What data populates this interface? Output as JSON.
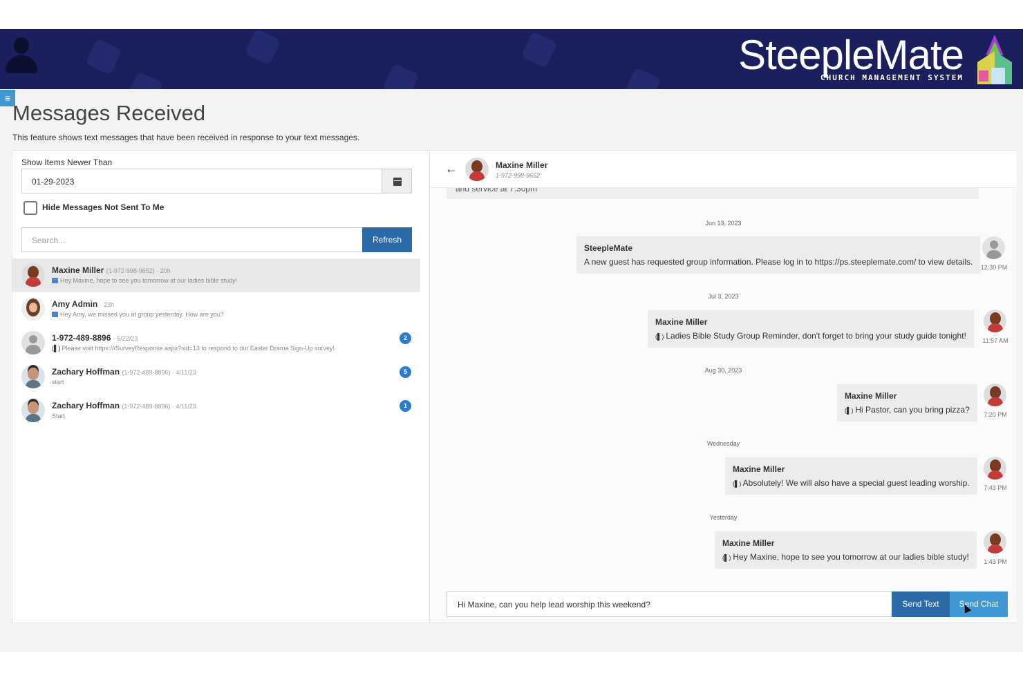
{
  "brand": {
    "name": "SteepleMate",
    "tagline": "CHURCH MANAGEMENT SYSTEM",
    "navy": "#1b1f5e",
    "accent_blue": "#2b6aa6",
    "light_blue": "#3f97d4"
  },
  "header": {
    "menu_icon": "hamburger-icon",
    "user_icon": "user-silhouette-icon"
  },
  "page": {
    "title": "Messages Received",
    "description": "This feature shows text messages that have been received in response to your text messages."
  },
  "filters": {
    "date_label": "Show Items Newer Than",
    "date_value": "01-29-2023",
    "hide_label": "Hide Messages Not Sent To Me",
    "hide_checked": false,
    "search_placeholder": "Search...",
    "refresh_label": "Refresh"
  },
  "conversations": [
    {
      "name": "Maxine Miller",
      "meta": "(1-972-998-9652) · 20h",
      "snippet": "Hey Maxine, hope to see you tomorrow at our ladies bible study!",
      "badge": "",
      "active": true
    },
    {
      "name": "Amy Admin",
      "meta": "· 23h",
      "snippet": "Hey Amy, we missed you at group yesterday. How are you?",
      "badge": "",
      "active": false
    },
    {
      "name": "1-972-489-8896",
      "meta": "· 5/22/23",
      "snippet": "Please visit https:///SurveyResponse.aspx?sid=13 to respond to our Easter Drama Sign-Up survey!",
      "badge": "2",
      "active": false
    },
    {
      "name": "Zachary Hoffman",
      "meta": "(1-972-489-8896) · 4/11/23",
      "snippet": "start",
      "badge": "5",
      "active": false
    },
    {
      "name": "Zachary Hoffman",
      "meta": "(1-972-489-8896) · 4/11/23",
      "snippet": "Start",
      "badge": "1",
      "active": false
    }
  ],
  "chat": {
    "contact_name": "Maxine Miller",
    "contact_phone": "1-972-998-9652",
    "cutoff_text": "and service at 7:30pm",
    "messages": [
      {
        "date": "Jun 13, 2023",
        "sender": "SteepleMate",
        "text": "A new guest has requested group information. Please log in to https://ps.steeplemate.com/ to view details.",
        "time": "12:30 PM"
      },
      {
        "date": "Jul 3, 2023",
        "sender": "Maxine Miller",
        "text": "Ladies Bible Study Group Reminder, don't forget to bring your study guide tonight!",
        "time": "11:57 AM"
      },
      {
        "date": "Aug 30, 2023",
        "sender": "Maxine Miller",
        "text": "Hi Pastor, can you bring pizza?",
        "time": "7:20 PM"
      },
      {
        "date": "Wednesday",
        "sender": "Maxine Miller",
        "text": "Absolutely! We will also have a special guest leading worship.",
        "time": "7:43 PM"
      },
      {
        "date": "Yesterday",
        "sender": "Maxine Miller",
        "text": "Hey Maxine, hope to see you tomorrow at our ladies bible study!",
        "time": "1:43 PM"
      }
    ],
    "compose_value": "Hi Maxine, can you help lead worship this weekend?",
    "send_text_label": "Send Text",
    "send_chat_label": "Send Chat"
  }
}
